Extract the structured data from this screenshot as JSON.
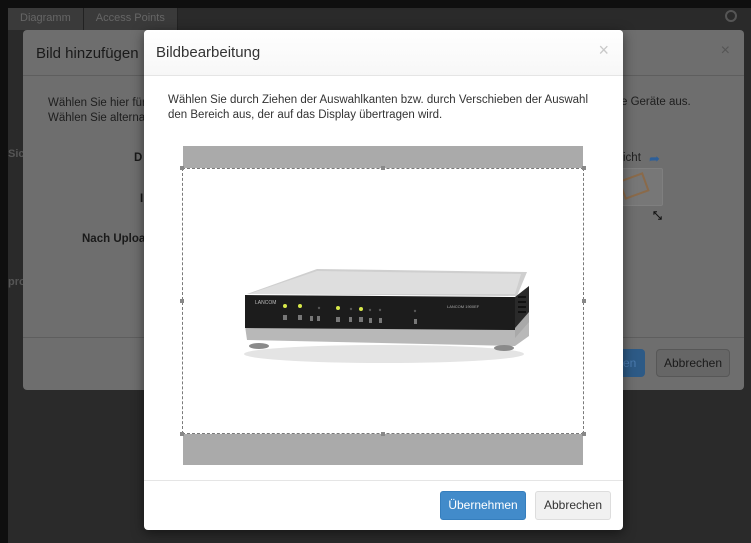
{
  "background_page": {
    "tabs": [
      "Diagramm",
      "Access Points"
    ],
    "left_fragments": [
      "Sic",
      "pro"
    ]
  },
  "outer_dialog": {
    "title": "Bild hinzufügen",
    "close": "×",
    "description_left": "Wählen Sie hier für Wählen Sie alterna",
    "description_right": "e Geräte aus.",
    "label_d": "D",
    "label_i": "I",
    "label_upload": "Nach Uploa",
    "preview_label": "icht",
    "apply_fragment": "en",
    "cancel_label": "Abbrechen"
  },
  "dialog": {
    "title": "Bildbearbeitung",
    "close": "×",
    "instruction": "Wählen Sie durch Ziehen der Auswahlkanten bzw. durch Verschieben der Auswahl den Bereich aus, der auf das Display übertragen wird.",
    "apply_label": "Übernehmen",
    "cancel_label": "Abbrechen"
  },
  "image": {
    "brand_text": "LANCOM",
    "model_text": "LANCOM 1900EF"
  },
  "colors": {
    "primary": "#428bca",
    "crop_background": "#aaaaaa",
    "overlay": "#0f0f0f"
  }
}
